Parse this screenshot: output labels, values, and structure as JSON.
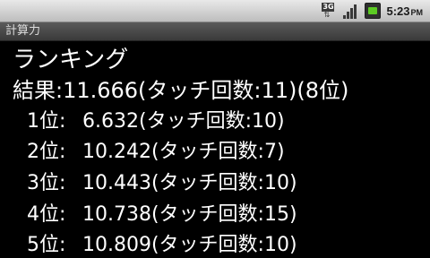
{
  "status_bar": {
    "network_label": "3G",
    "time": "5:23",
    "ampm": "PM"
  },
  "app": {
    "title": "計算力"
  },
  "main": {
    "heading": "ランキング",
    "result": "結果:11.666(タッチ回数:11)(8位)",
    "ranks": [
      {
        "position": "1位:",
        "record": "6.632(タッチ回数:10)"
      },
      {
        "position": "2位:",
        "record": "10.242(タッチ回数:7)"
      },
      {
        "position": "3位:",
        "record": "10.443(タッチ回数:10)"
      },
      {
        "position": "4位:",
        "record": "10.738(タッチ回数:15)"
      },
      {
        "position": "5位:",
        "record": "10.809(タッチ回数:10)"
      }
    ]
  }
}
